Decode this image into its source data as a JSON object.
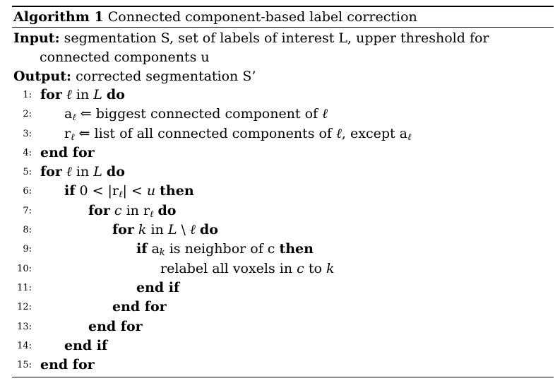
{
  "caption": {
    "label": "Algorithm 1",
    "title": "Connected component-based label correction"
  },
  "input": {
    "label": "Input:",
    "text_line1": "segmentation S, set of labels of interest L, upper threshold for",
    "text_line2": "connected components u"
  },
  "output": {
    "label": "Output:",
    "text": "corrected segmentation S’"
  },
  "lines": [
    {
      "num": "1:",
      "indent": 0,
      "text": "for ℓ in L do"
    },
    {
      "num": "2:",
      "indent": 1,
      "text": "aℓ ⇐ biggest connected component of ℓ"
    },
    {
      "num": "3:",
      "indent": 1,
      "text": "rℓ ⇐ list of all connected components of ℓ, except aℓ"
    },
    {
      "num": "4:",
      "indent": 0,
      "text": "end for"
    },
    {
      "num": "5:",
      "indent": 0,
      "text": "for ℓ in L do"
    },
    {
      "num": "6:",
      "indent": 1,
      "text": "if 0 < |rℓ| < u then"
    },
    {
      "num": "7:",
      "indent": 2,
      "text": "for c in rℓ do"
    },
    {
      "num": "8:",
      "indent": 3,
      "text": "for k in L \\ ℓ do"
    },
    {
      "num": "9:",
      "indent": 4,
      "text": "if ak is neighbor of c then"
    },
    {
      "num": "10:",
      "indent": 5,
      "text": "relabel all voxels in c to k"
    },
    {
      "num": "11:",
      "indent": 4,
      "text": "end if"
    },
    {
      "num": "12:",
      "indent": 3,
      "text": "end for"
    },
    {
      "num": "13:",
      "indent": 2,
      "text": "end for"
    },
    {
      "num": "14:",
      "indent": 1,
      "text": "end if"
    },
    {
      "num": "15:",
      "indent": 0,
      "text": "end for"
    }
  ]
}
